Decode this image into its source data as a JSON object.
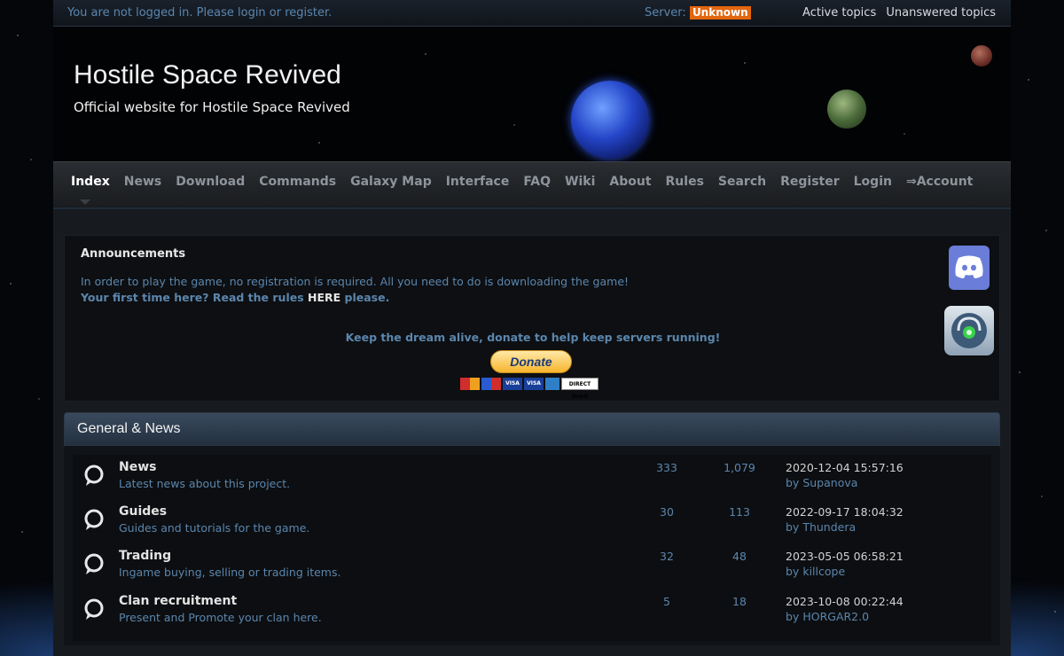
{
  "topbar": {
    "login_note": "You are not logged in. Please login or register.",
    "server_label": "Server:",
    "server_status": "Unknown",
    "server_status_color": "#e3660f",
    "links": [
      "Active topics",
      "Unanswered topics"
    ]
  },
  "header": {
    "title": "Hostile Space Revived",
    "subtitle": "Official website for Hostile Space Revived"
  },
  "nav": {
    "items": [
      "Index",
      "News",
      "Download",
      "Commands",
      "Galaxy Map",
      "Interface",
      "FAQ",
      "Wiki",
      "About",
      "Rules",
      "Search",
      "Register",
      "Login",
      "⇒Account"
    ],
    "active": "Index"
  },
  "announcements": {
    "title": "Announcements",
    "line1": "In order to play the game, no registration is required. All you need to do is downloading the game!",
    "line2_prefix": "Your first time here? Read the rules ",
    "line2_link": "HERE",
    "line2_suffix": " please.",
    "donate_note": "Keep the dream alive, donate to help keep servers running!",
    "donate_button": "Donate",
    "cards": [
      "MasterCard",
      "Maestro",
      "VISA",
      "VISA",
      "AMEX",
      "DIRECT Debit"
    ]
  },
  "side_icons": [
    "discord-icon",
    "teamspeak-icon"
  ],
  "forum": {
    "section_title": "General & News",
    "rows": [
      {
        "name": "News",
        "desc": "Latest news about this project.",
        "topics": "333",
        "posts": "1,079",
        "last_date": "2020-12-04 15:57:16",
        "by_label": "by",
        "last_user": "Supanova"
      },
      {
        "name": "Guides",
        "desc": "Guides and tutorials for the game.",
        "topics": "30",
        "posts": "113",
        "last_date": "2022-09-17 18:04:32",
        "by_label": "by",
        "last_user": "Thundera"
      },
      {
        "name": "Trading",
        "desc": "Ingame buying, selling or trading items.",
        "topics": "32",
        "posts": "48",
        "last_date": "2023-05-05 06:58:21",
        "by_label": "by",
        "last_user": "killcope"
      },
      {
        "name": "Clan recruitment",
        "desc": "Present and Promote your clan here.",
        "topics": "5",
        "posts": "18",
        "last_date": "2023-10-08 00:22:44",
        "by_label": "by",
        "last_user": "HORGAR2.0"
      }
    ]
  }
}
